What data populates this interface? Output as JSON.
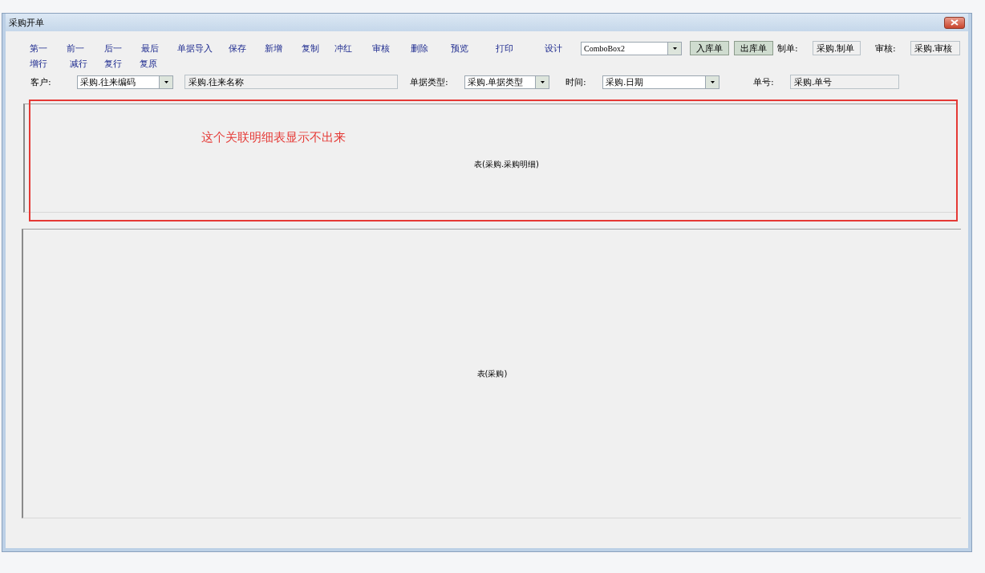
{
  "window": {
    "title": "采购开单"
  },
  "toolbar": {
    "row1": [
      "第一",
      "前一",
      "后一",
      "最后",
      "单据导入",
      "保存",
      "新增",
      "复制",
      "冲红",
      "审核",
      "删除",
      "预览",
      "打印",
      "设计"
    ],
    "row2": [
      "增行",
      "减行",
      "复行",
      "复原"
    ],
    "combo": {
      "value": "ComboBox2"
    },
    "action_buttons": [
      "入库单",
      "出库单"
    ],
    "maker": {
      "label": "制单:",
      "value": "采购.制单"
    },
    "reviewer": {
      "label": "审核:",
      "value": "采购.审核"
    }
  },
  "fields": {
    "customer": {
      "label": "客户:",
      "code": "采购.往来编码",
      "name": "采购.往来名称"
    },
    "bill_type": {
      "label": "单据类型:",
      "value": "采购.单据类型"
    },
    "time": {
      "label": "时间:",
      "value": "采购.日期"
    },
    "bill_no": {
      "label": "单号:",
      "value": "采购.单号"
    }
  },
  "detail_table": {
    "label": "表(采购.采购明细)",
    "annotation": "这个关联明细表显示不出来"
  },
  "main_table": {
    "label": "表(采购)"
  }
}
